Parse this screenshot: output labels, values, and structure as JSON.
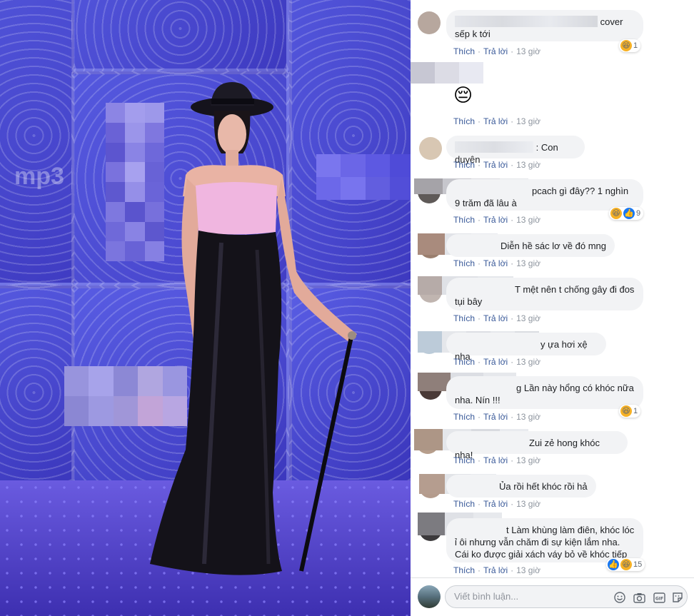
{
  "comments": [
    {
      "text": "cover sếp k tới",
      "actions": {
        "like": "Thích",
        "reply": "Trả lời",
        "time": "13 giờ"
      },
      "reaction_count": "1"
    },
    {
      "emoji": "😔",
      "actions": {
        "like": "Thích",
        "reply": "Trả lời",
        "time": "13 giờ"
      }
    },
    {
      "text": ": Con duyên",
      "actions": {
        "like": "Thích",
        "reply": "Trả lời",
        "time": "13 giờ"
      }
    },
    {
      "text": "pcach gì đây?? 1 nghìn 9 trăm đã lâu à",
      "actions": {
        "like": "Thích",
        "reply": "Trả lời",
        "time": "13 giờ"
      },
      "reaction_count": "9"
    },
    {
      "text": "Diễn hề sác lơ về đó mng",
      "actions": {
        "like": "Thích",
        "reply": "Trả lời",
        "time": "13 giờ"
      }
    },
    {
      "text": "T mệt nên t chống gây đi đos tụi bây",
      "actions": {
        "like": "Thích",
        "reply": "Trả lời",
        "time": "13 giờ"
      }
    },
    {
      "text": "y ựa hơi xệ nha",
      "actions": {
        "like": "Thích",
        "reply": "Trả lời",
        "time": "13 giờ"
      }
    },
    {
      "text": "g Lần này hổng có khóc nữa nha. Nín !!!",
      "actions": {
        "like": "Thích",
        "reply": "Trả lời",
        "time": "13 giờ"
      },
      "reaction_count": "1"
    },
    {
      "text": "Zui zẻ hong khóc nha!",
      "actions": {
        "like": "Thích",
        "reply": "Trả lời",
        "time": "13 giờ"
      }
    },
    {
      "text": "Ủa rồi hết khóc rồi hả",
      "actions": {
        "like": "Thích",
        "reply": "Trả lời",
        "time": "13 giờ"
      }
    },
    {
      "text": "t Làm khùng làm điên, khóc lóc ỉ ôi nhưng vẫn chăm đi sự kiện lắm nha. Cái ko được giải xách váy bỏ về khóc tiếp",
      "actions": {
        "like": "Thích",
        "reply": "Trả lời",
        "time": "13 giờ"
      },
      "reaction_count": "15"
    }
  ],
  "write_bar": {
    "placeholder": "Viết bình luận...",
    "icons": [
      "emoji-icon",
      "camera-icon",
      "gif-icon",
      "sticker-icon"
    ]
  },
  "photo": {
    "stage_text": "mp3"
  },
  "colors": {
    "link": "#385898",
    "meta": "#8d949e",
    "bubble": "#f2f3f5",
    "stage": "#4b4ccf"
  }
}
